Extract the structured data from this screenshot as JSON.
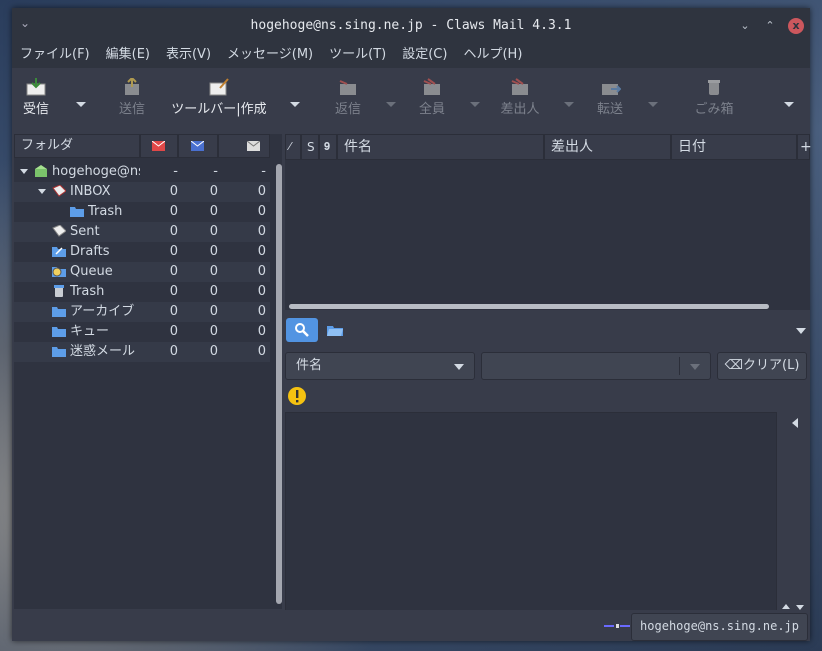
{
  "window": {
    "title": "hogehoge@ns.sing.ne.jp - Claws Mail 4.3.1",
    "close": "x",
    "minimize": "⌄",
    "maximize": "⌃"
  },
  "menu": [
    "ファイル(F)",
    "編集(E)",
    "表示(V)",
    "メッセージ(M)",
    "ツール(T)",
    "設定(C)",
    "ヘルプ(H)"
  ],
  "toolbar": {
    "receive": "受信",
    "send": "送信",
    "compose": "ツールバー|作成",
    "reply": "返信",
    "reply_all": "全員",
    "reply_sender": "差出人",
    "forward": "転送",
    "trash": "ごみ箱"
  },
  "folder_header": {
    "label": "フォルダ"
  },
  "folders": [
    {
      "name": "hogehoge@ns",
      "n1": "-",
      "n2": "-",
      "n3": "-"
    },
    {
      "name": "INBOX",
      "n1": "0",
      "n2": "0",
      "n3": "0"
    },
    {
      "name": "Trash",
      "n1": "0",
      "n2": "0",
      "n3": "0"
    },
    {
      "name": "Sent",
      "n1": "0",
      "n2": "0",
      "n3": "0"
    },
    {
      "name": "Drafts",
      "n1": "0",
      "n2": "0",
      "n3": "0"
    },
    {
      "name": "Queue",
      "n1": "0",
      "n2": "0",
      "n3": "0"
    },
    {
      "name": "Trash",
      "n1": "0",
      "n2": "0",
      "n3": "0"
    },
    {
      "name": "アーカイブ",
      "n1": "0",
      "n2": "0",
      "n3": "0"
    },
    {
      "name": "キュー",
      "n1": "0",
      "n2": "0",
      "n3": "0"
    },
    {
      "name": "迷惑メール",
      "n1": "0",
      "n2": "0",
      "n3": "0"
    }
  ],
  "message_list": {
    "col_s": "S",
    "col_subject": "件名",
    "col_from": "差出人",
    "col_date": "日付"
  },
  "quicksearch": {
    "type": "件名",
    "value": "",
    "clear": "クリア(L)"
  },
  "status": {
    "account": "hogehoge@ns.sing.ne.jp"
  },
  "colors": {
    "accent": "#5294e2",
    "warn": "#f5c211"
  }
}
